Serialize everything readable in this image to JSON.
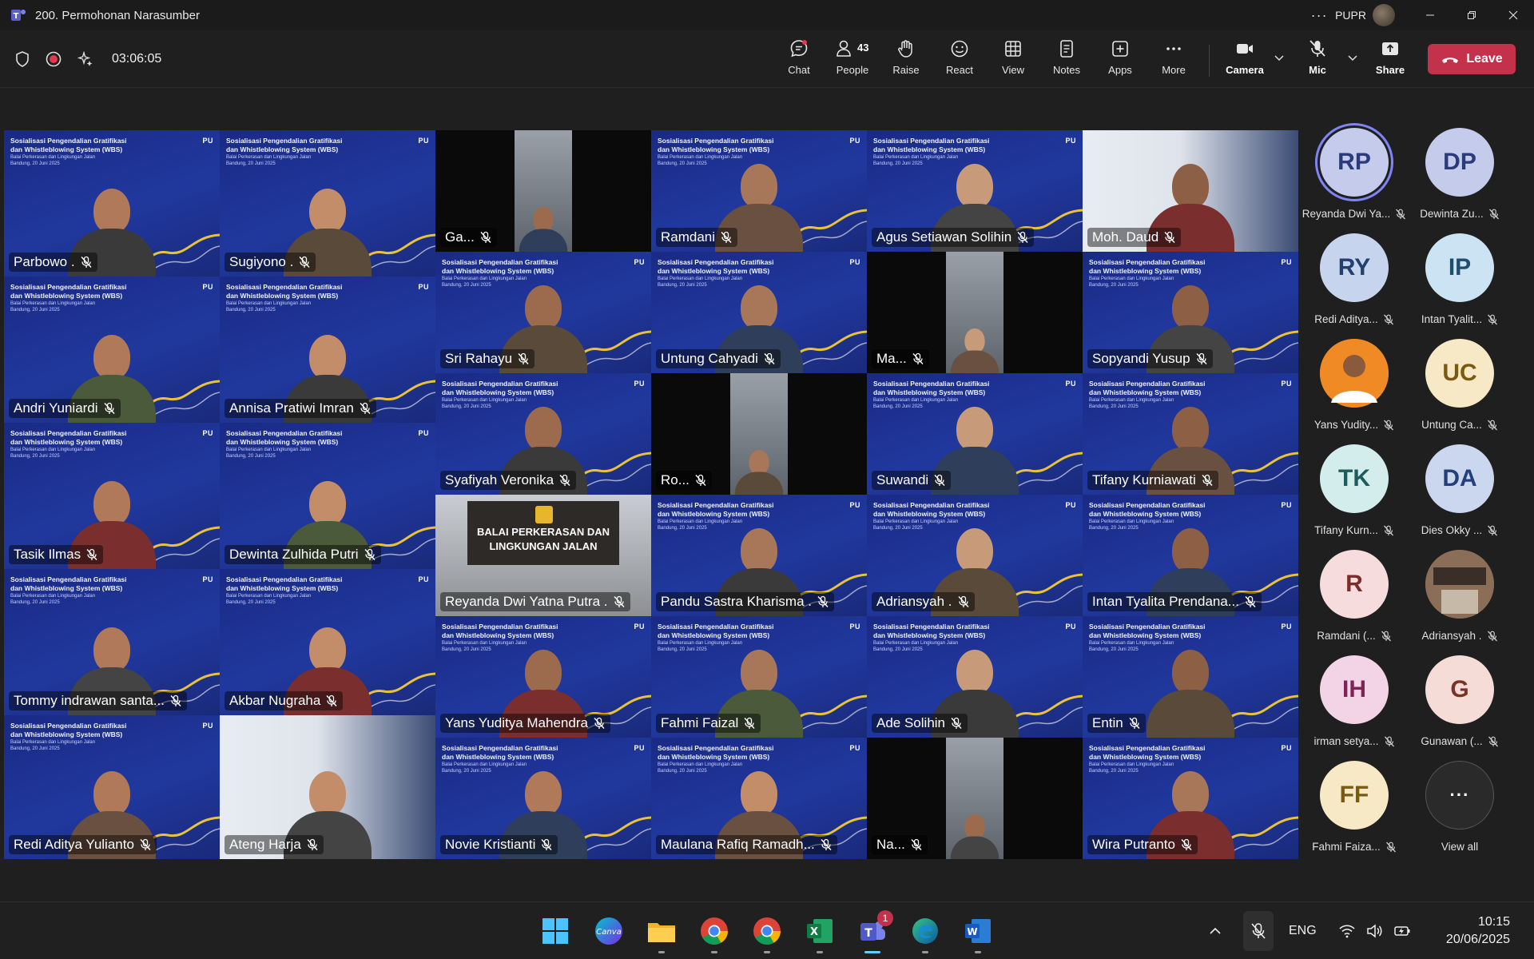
{
  "titlebar": {
    "title": "200. Permohonan Narasumber",
    "org": "PUPR",
    "more": "···"
  },
  "toolbar": {
    "timer": "03:06:05",
    "chat": "Chat",
    "people": "People",
    "people_count": "43",
    "raise": "Raise",
    "react": "React",
    "view": "View",
    "notes": "Notes",
    "apps": "Apps",
    "more": "More",
    "camera": "Camera",
    "mic": "Mic",
    "share": "Share",
    "leave": "Leave"
  },
  "banner": {
    "line1": "Sosialisasi Pengendalian Gratifikasi",
    "line2": "dan Whistleblowing System (WBS)",
    "sub": "Balai Perkerasan dan Lingkungan Jalan",
    "date": "Bandung, 20 Juni 2025",
    "logo": "PU"
  },
  "room_sign": {
    "line1": "BALAI PERKERASAN DAN",
    "line2": "LINGKUNGAN JALAN"
  },
  "tiles": [
    {
      "name": "Parbowo ."
    },
    {
      "name": "Sugiyono ."
    },
    {
      "name": "Ga..."
    },
    {
      "name": "Ramdani"
    },
    {
      "name": "Agus Setiawan Solihin"
    },
    {
      "name": "Moh. Daud"
    },
    {
      "name": "Andri Yuniardi"
    },
    {
      "name": "Annisa Pratiwi Imran"
    },
    {
      "name": "Sri Rahayu"
    },
    {
      "name": "Untung Cahyadi"
    },
    {
      "name": "Ma..."
    },
    {
      "name": "Sopyandi Yusup"
    },
    {
      "name": "Tasik Ilmas"
    },
    {
      "name": "Dewinta Zulhida Putri"
    },
    {
      "name": "Syafiyah Veronika"
    },
    {
      "name": "Ro..."
    },
    {
      "name": "Suwandi"
    },
    {
      "name": "Tifany Kurniawati"
    },
    {
      "name": "Tommy indrawan santa..."
    },
    {
      "name": "Akbar Nugraha"
    },
    {
      "name": "Reyanda Dwi Yatna Putra ."
    },
    {
      "name": "Pandu Sastra Kharisma ."
    },
    {
      "name": "Adriansyah ."
    },
    {
      "name": "Intan Tyalita Prendana..."
    },
    {
      "name": "Redi Aditya Yulianto"
    },
    {
      "name": "Ateng Harja"
    },
    {
      "name": "Yans Yuditya Mahendra"
    },
    {
      "name": "Fahmi Faizal"
    },
    {
      "name": "Ade Solihin"
    },
    {
      "name": "Entin"
    },
    {
      "name": "Novie Kristianti"
    },
    {
      "name": "Maulana Rafiq Ramadh..."
    },
    {
      "name": "Na..."
    },
    {
      "name": "Wira Putranto"
    }
  ],
  "roster": [
    {
      "initials": "RP",
      "name": "Reyanda Dwi Ya...",
      "color": "#c5cbeb",
      "text": "#2b3a7a"
    },
    {
      "initials": "DP",
      "name": "Dewinta Zu...",
      "color": "#c5cbeb",
      "text": "#2b3a7a"
    },
    {
      "initials": "RY",
      "name": "Redi Aditya...",
      "color": "#c7d4ee",
      "text": "#24406e"
    },
    {
      "initials": "IP",
      "name": "Intan Tyalit...",
      "color": "#cbe3f2",
      "text": "#1e4f6e"
    },
    {
      "initials": "",
      "name": "Yans Yudity...",
      "color": "#f08a24",
      "text": "#ffffff"
    },
    {
      "initials": "UC",
      "name": "Untung Ca...",
      "color": "#f7e9c6",
      "text": "#7a5a12"
    },
    {
      "initials": "TK",
      "name": "Tifany Kurn...",
      "color": "#d3ecec",
      "text": "#1e5c5c"
    },
    {
      "initials": "DA",
      "name": "Dies Okky ...",
      "color": "#cbd6ef",
      "text": "#23407a"
    },
    {
      "initials": "R",
      "name": "Ramdani (...",
      "color": "#f6dcdc",
      "text": "#7a2d2d"
    },
    {
      "initials": "",
      "name": "Adriansyah .",
      "color": "#8a6e58",
      "text": "#ffffff"
    },
    {
      "initials": "IH",
      "name": "irman setya...",
      "color": "#f3d4e6",
      "text": "#7a2457"
    },
    {
      "initials": "G",
      "name": "Gunawan (...",
      "color": "#f5dcd6",
      "text": "#7a3325"
    },
    {
      "initials": "FF",
      "name": "Fahmi Faiza...",
      "color": "#f7e9c6",
      "text": "#7a5a12"
    },
    {
      "initials": "···",
      "name": "View all",
      "color": "#2a2a2a",
      "text": "#ffffff"
    }
  ],
  "taskbar": {
    "lang": "ENG",
    "time": "10:15",
    "date": "20/06/2025",
    "teams_badge": "1"
  }
}
